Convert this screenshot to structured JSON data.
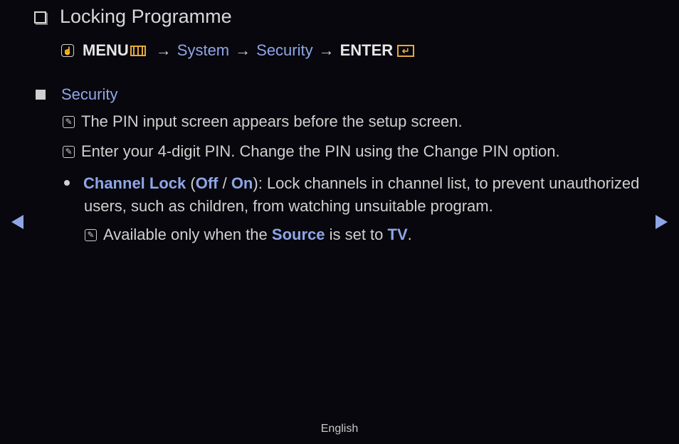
{
  "title": "Locking Programme",
  "path": {
    "menu_label": "MENU",
    "arrow": "→",
    "steps": [
      "System",
      "Security"
    ],
    "enter_label": "ENTER",
    "enter_glyph": "↵",
    "hand_glyph": "☝"
  },
  "section": {
    "heading": "Security",
    "note_glyph": "✎",
    "notes": [
      "The PIN input screen appears before the setup screen.",
      "Enter your 4-digit PIN. Change the PIN using the Change PIN option."
    ],
    "bullet": {
      "label": "Channel Lock",
      "open_paren": " (",
      "option1": "Off",
      "sep": " / ",
      "option2": "On",
      "close": "): ",
      "text": "Lock channels in channel list, to prevent unauthorized users, such as children, from watching unsuitable program."
    },
    "subnote": {
      "prefix": "Available only when the ",
      "source": "Source",
      "middle": " is set to ",
      "tv": "TV",
      "end": "."
    }
  },
  "nav": {
    "prev_icon": "triangle-left",
    "next_icon": "triangle-right"
  },
  "footer": {
    "language": "English"
  }
}
